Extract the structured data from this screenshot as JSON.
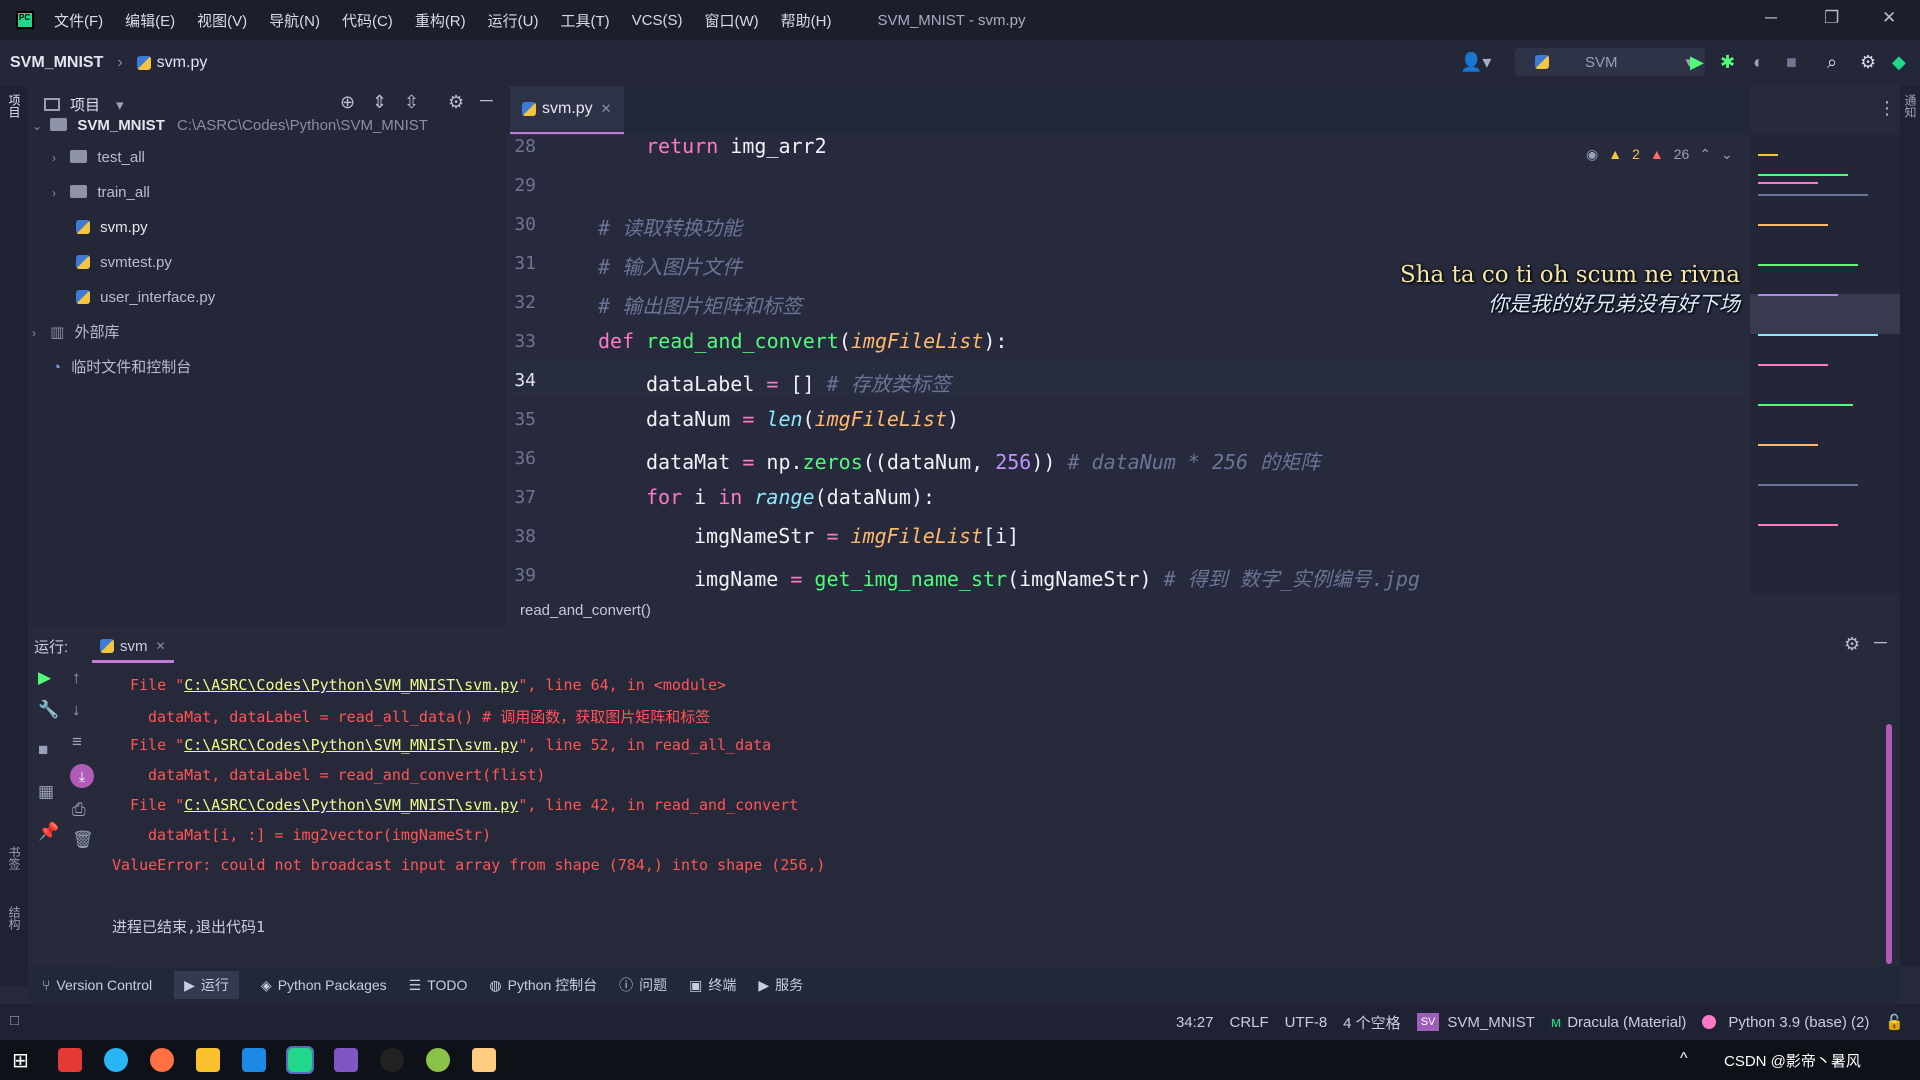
{
  "app": {
    "menu": [
      "文件(F)",
      "编辑(E)",
      "视图(V)",
      "导航(N)",
      "代码(C)",
      "重构(R)",
      "运行(U)",
      "工具(T)",
      "VCS(S)",
      "窗口(W)",
      "帮助(H)"
    ],
    "window_title": "SVM_MNIST - svm.py",
    "controls": [
      "─",
      "❐",
      "✕"
    ]
  },
  "nav": {
    "project": "SVM_MNIST",
    "file": "svm.py",
    "run_config": "SVM"
  },
  "project_panel": {
    "title": "项目",
    "root_name": "SVM_MNIST",
    "root_path": "C:\\ASRC\\Codes\\Python\\SVM_MNIST",
    "items": [
      {
        "label": "test_all",
        "type": "folder"
      },
      {
        "label": "train_all",
        "type": "folder"
      },
      {
        "label": "svm.py",
        "type": "file"
      },
      {
        "label": "svmtest.py",
        "type": "file"
      },
      {
        "label": "user_interface.py",
        "type": "file"
      },
      {
        "label": "外部库",
        "type": "lib"
      },
      {
        "label": "临时文件和控制台",
        "type": "scratch"
      }
    ]
  },
  "editor": {
    "tab": "svm.py",
    "warnings": "2",
    "weak_warnings": "26",
    "line_numbers": [
      "28",
      "29",
      "30",
      "31",
      "32",
      "33",
      "34",
      "35",
      "36",
      "37",
      "38",
      "39"
    ],
    "breadcrumb": "read_and_convert()",
    "code": {
      "l28_kw": "return",
      "l28_rest": " img_arr2",
      "l30": "# 读取转换功能",
      "l31": "# 输入图片文件",
      "l32": "# 输出图片矩阵和标签",
      "l33_kw": "def ",
      "l33_fn": "read_and_convert",
      "l33_p1": "(",
      "l33_arg": "imgFileList",
      "l33_p2": "):",
      "l34_a": "dataLabel",
      "l34_b": " = ",
      "l34_c": "[]",
      "l34_cm": " # 存放类标签",
      "l35_a": "dataNum",
      "l35_b": " = ",
      "l35_c": "len",
      "l35_d": "(",
      "l35_e": "imgFileList",
      "l35_f": ")",
      "l36_a": "dataMat",
      "l36_b": " = ",
      "l36_c": "np.",
      "l36_d": "zeros",
      "l36_e": "((dataNum, ",
      "l36_f": "256",
      "l36_g": "))",
      "l36_cm": " # dataNum * 256 的矩阵",
      "l37_kw1": "for",
      "l37_b": " i ",
      "l37_kw2": "in",
      "l37_c": " ",
      "l37_d": "range",
      "l37_e": "(dataNum):",
      "l38_a": "imgNameStr",
      "l38_b": " = ",
      "l38_c": "imgFileList",
      "l38_d": "[i]",
      "l39_a": "imgName",
      "l39_b": " = ",
      "l39_c": "get_img_name_str",
      "l39_d": "(imgNameStr)",
      "l39_cm": " # 得到 数字_实例编号.jpg"
    }
  },
  "lyrics": {
    "line1": "Sha ta co ti oh scum ne rivna",
    "line2": "你是我的好兄弟没有好下场"
  },
  "run_panel": {
    "label": "运行:",
    "tab": "svm",
    "console": [
      {
        "pre": "File \"",
        "link": "C:\\ASRC\\Codes\\Python\\SVM_MNIST\\svm.py",
        "post": "\", line 64, in <module>"
      },
      {
        "text": "dataMat, dataLabel = read_all_data() # 调用函数，获取图片矩阵和标签"
      },
      {
        "pre": "File \"",
        "link": "C:\\ASRC\\Codes\\Python\\SVM_MNIST\\svm.py",
        "post": "\", line 52, in read_all_data"
      },
      {
        "text": "dataMat, dataLabel = read_and_convert(flist)"
      },
      {
        "pre": "File \"",
        "link": "C:\\ASRC\\Codes\\Python\\SVM_MNIST\\svm.py",
        "post": "\", line 42, in read_and_convert"
      },
      {
        "text": "dataMat[i, :] = img2vector(imgNameStr)"
      },
      {
        "text": "ValueError: could not broadcast input array from shape (784,) into shape (256,)"
      },
      {
        "text": "进程已结束,退出代码1"
      }
    ]
  },
  "tool_tabs": [
    "Version Control",
    "运行",
    "Python Packages",
    "TODO",
    "Python 控制台",
    "问题",
    "终端",
    "服务"
  ],
  "status": {
    "position": "34:27",
    "line_sep": "CRLF",
    "encoding": "UTF-8",
    "indent": "4 个空格",
    "project_badge": "SV",
    "project": "SVM_MNIST",
    "theme": "Dracula (Material)",
    "interpreter": "Python 3.9 (base) (2)"
  },
  "side_labels": {
    "project": "项目",
    "bookmarks": "书签",
    "structure": "结构",
    "notifications": "通知"
  },
  "taskbar": {
    "tray_text": "CSDN @影帝丶暑风"
  }
}
